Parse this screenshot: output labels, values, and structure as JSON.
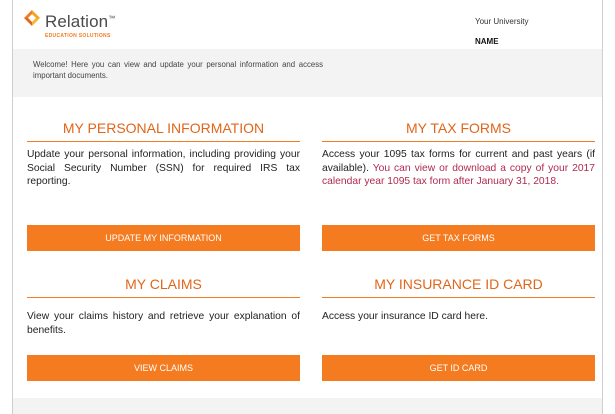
{
  "header": {
    "brand": "Relation",
    "brand_tm": "™",
    "brand_sub": "EDUCATION SOLUTIONS",
    "university": "Your University",
    "user_name": "NAME"
  },
  "welcome": {
    "text": "Welcome! Here you can view and update your personal information and access important documents."
  },
  "cards": {
    "personal": {
      "title": "MY PERSONAL INFORMATION",
      "body": "Update your personal information, including providing your Social Security Number (SSN) for required IRS tax reporting.",
      "button": "UPDATE MY INFORMATION"
    },
    "tax": {
      "title": "MY TAX FORMS",
      "body": "Access your 1095 tax forms for current and past years (if available). ",
      "body_highlight": "You can view or download a copy of your 2017 calendar year 1095 tax form after January 31, 2018.",
      "button": "GET TAX FORMS"
    },
    "claims": {
      "title": "MY CLAIMS",
      "body": "View your claims history and retrieve your explanation of benefits.",
      "button": "VIEW CLAIMS"
    },
    "idcard": {
      "title": "MY INSURANCE ID CARD",
      "body": "Access your insurance ID card here.",
      "button": "GET ID CARD"
    }
  },
  "colors": {
    "accent": "#f47b20",
    "title_orange": "#e0661a",
    "highlight": "#b02a50",
    "band_gray": "#f3f3f3"
  }
}
